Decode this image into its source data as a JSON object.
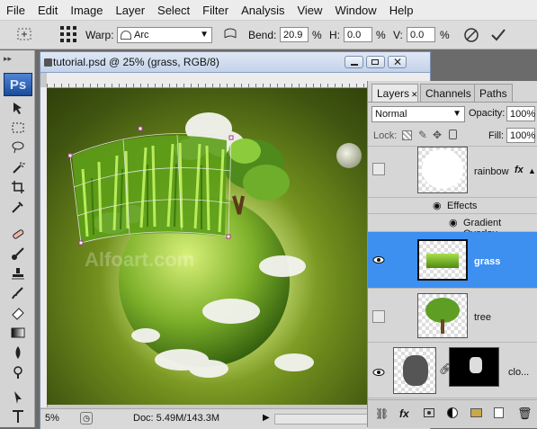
{
  "menu": [
    "File",
    "Edit",
    "Image",
    "Layer",
    "Select",
    "Filter",
    "Analysis",
    "View",
    "Window",
    "Help"
  ],
  "options": {
    "warp_label": "Warp:",
    "warp_value": "Arc",
    "bend_label": "Bend:",
    "bend_value": "20.9",
    "bend_unit": "%",
    "h_label": "H:",
    "h_value": "0.0",
    "h_unit": "%",
    "v_label": "V:",
    "v_value": "0.0",
    "v_unit": "%"
  },
  "toolbar": {
    "ps_logo": "Ps"
  },
  "document": {
    "title": "tutorial.psd @ 25% (grass, RGB/8)",
    "zoom": "5%",
    "doc_info": "Doc: 5.49M/143.3M",
    "watermark": "Alfoart.com"
  },
  "layers_panel": {
    "tabs": [
      "Layers",
      "Channels",
      "Paths"
    ],
    "blend_mode": "Normal",
    "opacity_label": "Opacity:",
    "opacity_value": "100%",
    "lock_label": "Lock:",
    "fill_label": "Fill:",
    "fill_value": "100%",
    "effects_label": "Effects",
    "gradient_overlay_label": "Gradient Overlay",
    "fx_label": "fx",
    "layers": [
      {
        "name": "rainbow",
        "selected": false
      },
      {
        "name": "grass",
        "selected": true
      },
      {
        "name": "tree",
        "selected": false
      },
      {
        "name": "clo...",
        "selected": false
      }
    ]
  },
  "colors": {
    "selection": "#3d8ff0",
    "ps_blue": "#1a4a9a"
  }
}
